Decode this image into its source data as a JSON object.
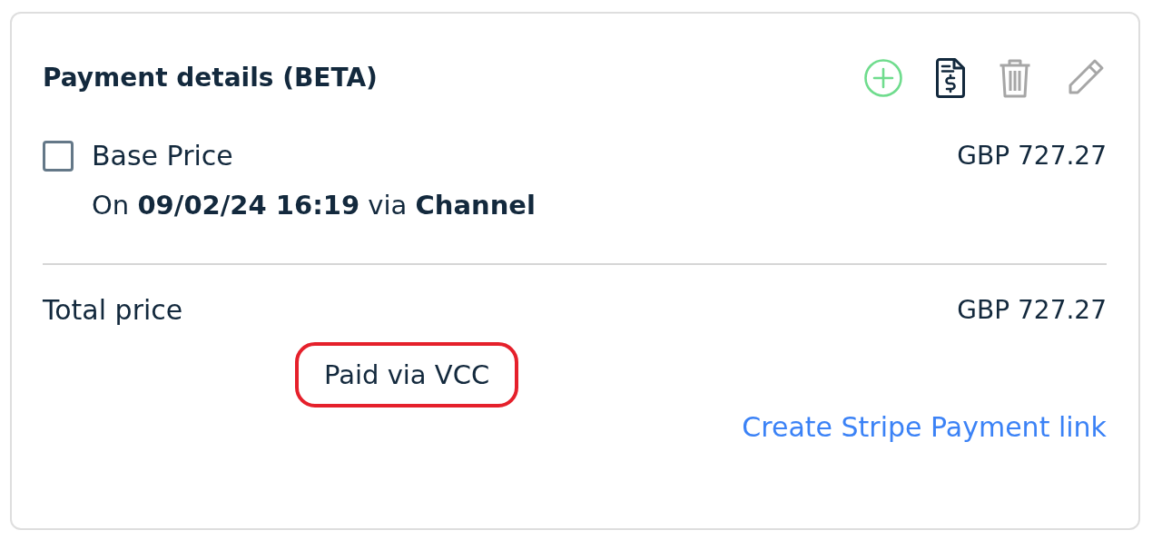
{
  "panel": {
    "title": "Payment details (BETA)",
    "actions": [
      {
        "kind": "add",
        "disabled": false
      },
      {
        "kind": "invoice",
        "disabled": false
      },
      {
        "kind": "delete",
        "disabled": true
      },
      {
        "kind": "edit",
        "disabled": true
      }
    ]
  },
  "items": [
    {
      "label": "Base Price",
      "checked": false,
      "amount": "GBP 727.27",
      "meta": "On **09/02/24 16:19** via **Channel**"
    }
  ],
  "total": {
    "label": "Total price",
    "amount": "GBP 727.27"
  },
  "payment_note": {
    "text": "Paid via VCC",
    "highlighted": true
  },
  "link": {
    "label": "Create Stripe Payment link"
  }
}
